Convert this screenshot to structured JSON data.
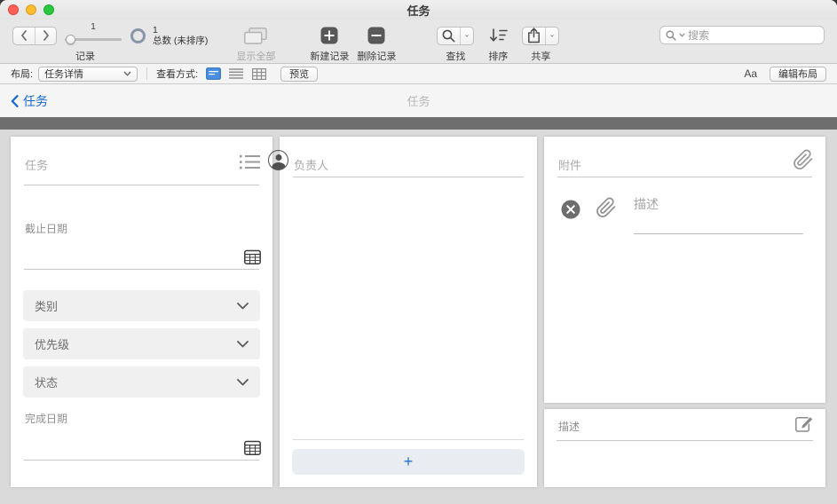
{
  "window": {
    "title": "任务"
  },
  "toolbar": {
    "record_nav": {
      "current": "1",
      "total": "1",
      "total_label": "总数 (未排序)",
      "caption": "记录"
    },
    "show_all": {
      "caption": "显示全部"
    },
    "new_record": {
      "caption": "新建记录"
    },
    "delete_record": {
      "caption": "删除记录"
    },
    "find": {
      "caption": "查找"
    },
    "sort": {
      "caption": "排序"
    },
    "share": {
      "caption": "共享"
    },
    "search": {
      "placeholder": "搜索"
    }
  },
  "layout_bar": {
    "layout_label": "布局:",
    "layout_selected": "任务详情",
    "view_as_label": "查看方式:",
    "preview": "预览",
    "text_format": "Aa",
    "edit_layout": "编辑布局"
  },
  "record_header": {
    "back": "任务",
    "title": "任务"
  },
  "detail_panel": {
    "task_label": "任务",
    "due_date_label": "截止日期",
    "dropdowns": [
      {
        "label": "类别"
      },
      {
        "label": "优先级"
      },
      {
        "label": "状态"
      }
    ],
    "completion_date_label": "完成日期"
  },
  "assignee_panel": {
    "label": "负责人",
    "add_label": "+"
  },
  "attachments_panel": {
    "label": "附件",
    "description_placeholder": "描述"
  },
  "description_panel": {
    "label": "描述"
  },
  "colors": {
    "accent_blue": "#1467d6",
    "dark_bar": "#6e6e6e"
  }
}
